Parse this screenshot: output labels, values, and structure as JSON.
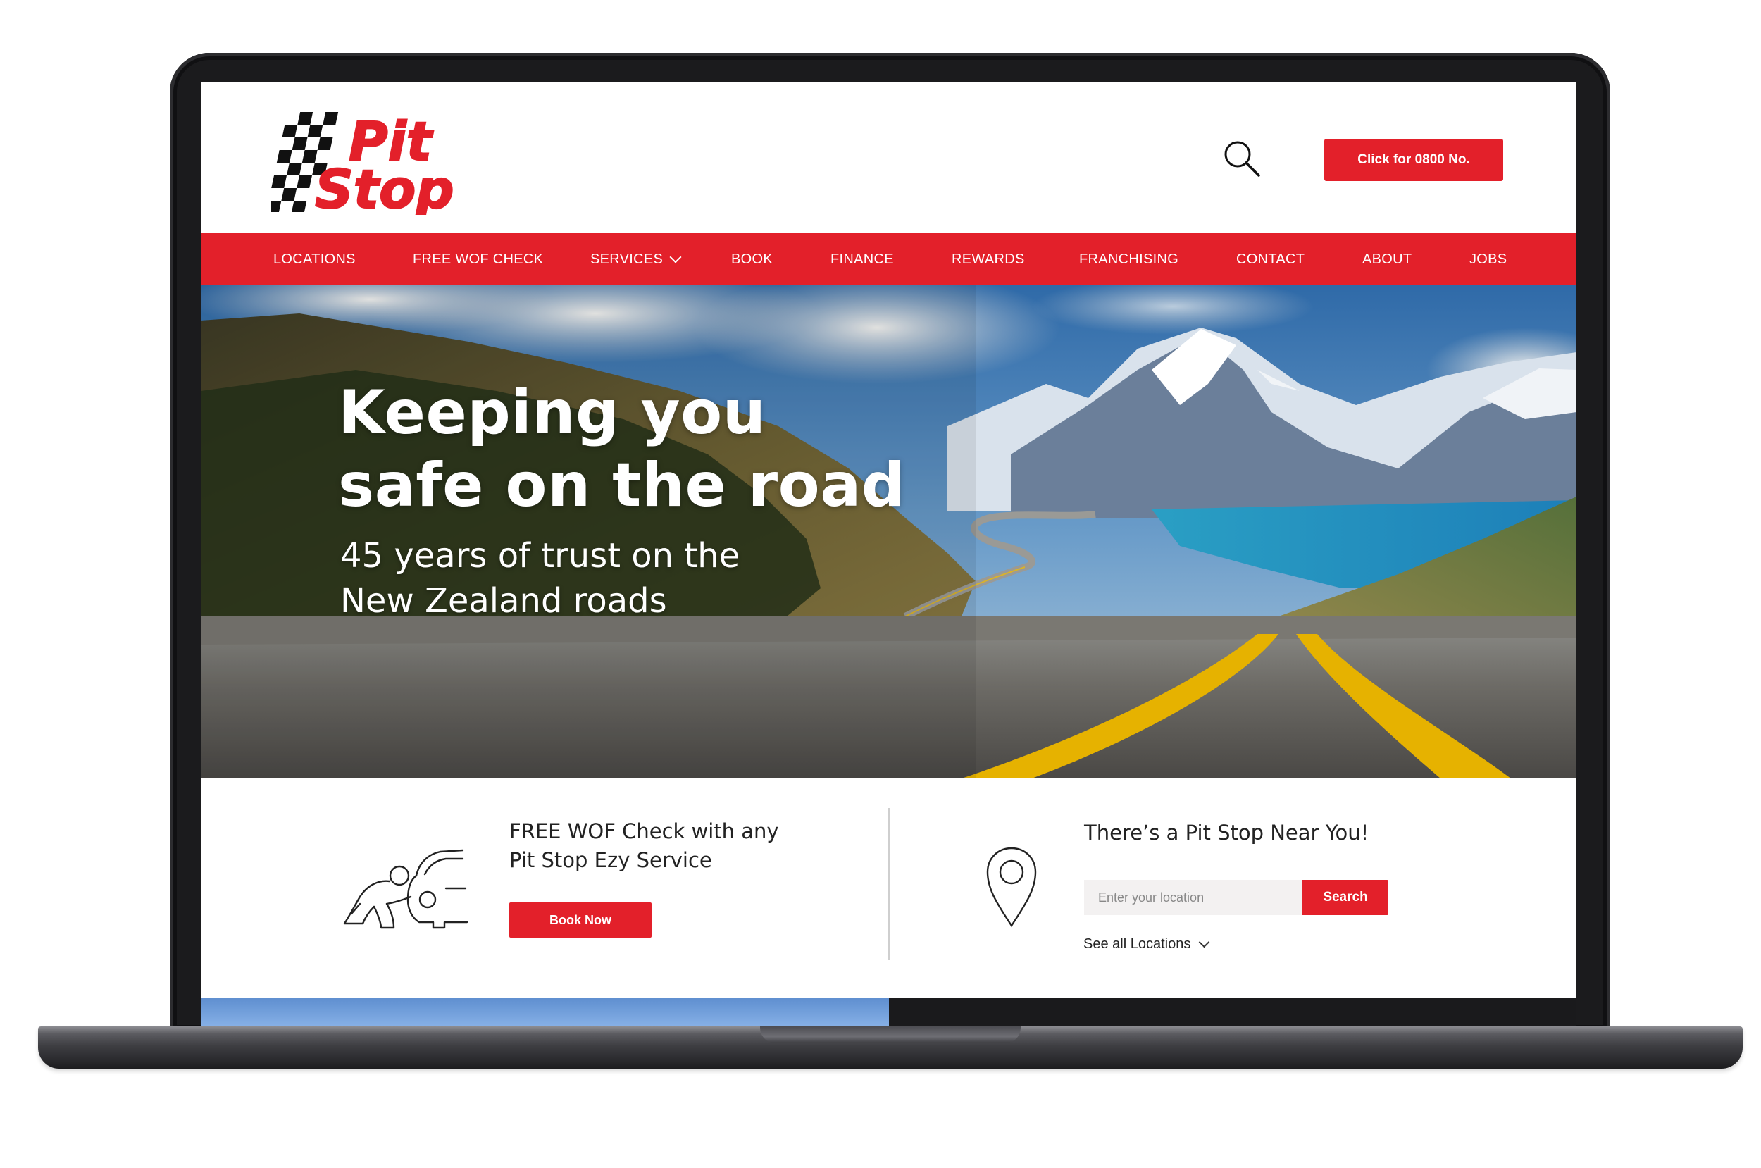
{
  "header": {
    "logo_alt": "Pit Stop",
    "search_icon": "search-icon",
    "call_button_label": "Click for 0800 No."
  },
  "nav": {
    "items": [
      {
        "label": "LOCATIONS"
      },
      {
        "label": "FREE WOF CHECK"
      },
      {
        "label": "SERVICES",
        "has_dropdown": true
      },
      {
        "label": "BOOK"
      },
      {
        "label": "FINANCE"
      },
      {
        "label": "REWARDS"
      },
      {
        "label": "FRANCHISING"
      },
      {
        "label": "CONTACT"
      },
      {
        "label": "ABOUT"
      },
      {
        "label": "JOBS"
      }
    ]
  },
  "hero": {
    "title_line1": "Keeping you",
    "title_line2": "safe on the road",
    "subtitle_line1": "45 years of trust on the",
    "subtitle_line2": "New Zealand roads"
  },
  "wof": {
    "icon": "mechanic-car-icon",
    "text_line1": "FREE WOF Check with any",
    "text_line2": "Pit Stop Ezy Service",
    "button_label": "Book Now"
  },
  "locator": {
    "icon": "location-pin-icon",
    "title": "There’s a Pit Stop Near You!",
    "input_placeholder": "Enter your location",
    "search_button_label": "Search",
    "see_all_label": "See all Locations"
  },
  "colors": {
    "brand_red": "#e3202a",
    "nav_text": "#ffffff",
    "body_text": "#222222"
  }
}
